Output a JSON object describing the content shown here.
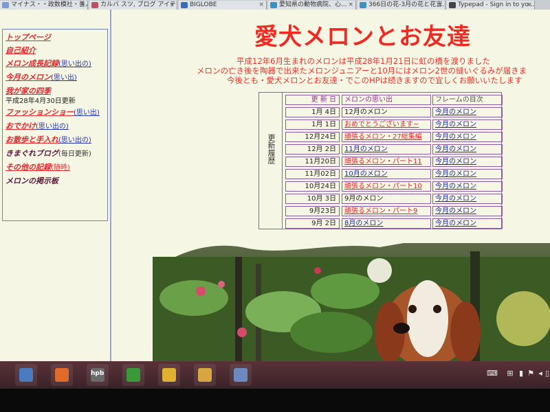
{
  "browser": {
    "tabs": [
      {
        "label": "マイナス・・政数模社・善人...",
        "color": "#7c9bd1"
      },
      {
        "label": "カルバ スツ, ブログ アイテクラ...",
        "color": "#c05060"
      },
      {
        "label": "BIGLOBE",
        "color": "#3a6ac0"
      },
      {
        "label": "愛知県の動物病院、心...",
        "color": "#3a90c0"
      },
      {
        "label": "366日の花-3月の花と花言...",
        "color": "#3a90c0"
      },
      {
        "label": "Typepad - Sign in to yo...",
        "color": "#444444"
      }
    ]
  },
  "sidebar": {
    "items": [
      {
        "label": "トップページ",
        "style": "red"
      },
      {
        "label": "自己紹介",
        "style": "red"
      },
      {
        "label": "メロン成長記録",
        "sub": "(思い出の)",
        "style": "red"
      },
      {
        "label": "今月のメロン",
        "sub": "(思い出)",
        "style": "red"
      },
      {
        "label": "我が家の四季",
        "style": "red",
        "note": "平成28年4月30日更新"
      },
      {
        "label": "ファッションショー",
        "sub": "(思い出)",
        "style": "red"
      },
      {
        "label": "おでかけ",
        "sub": "(思い出の)",
        "style": "red"
      },
      {
        "label": "お散歩と手入れ",
        "sub": "(思い出の)",
        "style": "red"
      },
      {
        "label": "きまぐれブログ",
        "sub": "(毎日更新)",
        "style": "dark"
      },
      {
        "label": "その他の記録",
        "sub": "(随時)",
        "style": "red"
      },
      {
        "label": "メロンの掲示板",
        "style": "dark"
      }
    ]
  },
  "main": {
    "title": "愛犬メロンとお友達",
    "intro": [
      "平成12年6月生まれのメロンは平成28年1月21日に虹の橋を渡りました",
      "メロンの亡き後を陶器で出来たメロンジュニアーと10月にはメロン2世の縫いぐるみが届きま",
      "今後とも・愛犬メロンとお友達・でこのHPは続きますので宜しくお願いいたします"
    ],
    "updates": {
      "side_label": "更新履歴",
      "headers": {
        "date": "更 新 日",
        "memory": "メロンの思い出",
        "frame": "フレームの目次"
      },
      "rows": [
        {
          "date": "1月 4日",
          "memory": "12月のメロン",
          "mstyle": "dark",
          "frame": "今月のメロン"
        },
        {
          "date": "1月 1日",
          "memory": "おめでとうございます~",
          "mstyle": "red",
          "frame": "今月のメロン"
        },
        {
          "date": "12月24日",
          "memory": "頑張るメロン・27総集編",
          "mstyle": "red",
          "frame": "今月のメロン"
        },
        {
          "date": "12月 2日",
          "memory": "11月のメロン",
          "mstyle": "blue",
          "frame": "今月のメロン"
        },
        {
          "date": "11月20日",
          "memory": "頑張るメロン・パート11",
          "mstyle": "red",
          "frame": "今月のメロン"
        },
        {
          "date": "11月02日",
          "memory": "10月のメロン",
          "mstyle": "blue",
          "frame": "今月のメロン"
        },
        {
          "date": "10月24日",
          "memory": "頑張るメロン・パート10",
          "mstyle": "red",
          "frame": "今月のメロン"
        },
        {
          "date": "10月 3日",
          "memory": "9月のメロン",
          "mstyle": "dark",
          "frame": "今月のメロン"
        },
        {
          "date": "9月23日",
          "memory": "頑張るメロン・パート9",
          "mstyle": "red",
          "frame": "今月のメロン"
        },
        {
          "date": "9月 2日",
          "memory": "8月のメロン",
          "mstyle": "blue",
          "frame": "今月のメロン"
        }
      ]
    }
  },
  "taskbar": {
    "hpb_label": "hpb",
    "apps": [
      {
        "name": "app-icon",
        "color": "#4a7ac0"
      },
      {
        "name": "firefox-icon",
        "color": "#e06a2a"
      },
      {
        "name": "hpb-icon",
        "color": "#6a6a6a"
      },
      {
        "name": "green-app-icon",
        "color": "#3a9a3a"
      },
      {
        "name": "chrome-icon",
        "color": "#e0b030"
      },
      {
        "name": "folder-icon",
        "color": "#d8a640"
      },
      {
        "name": "picture-app-icon",
        "color": "#6a8ac0"
      }
    ]
  }
}
